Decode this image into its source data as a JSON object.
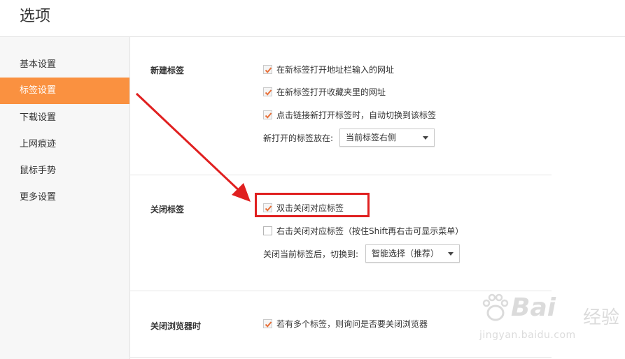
{
  "header": {
    "title": "选项"
  },
  "sidebar": {
    "items": [
      {
        "label": "基本设置",
        "active": false
      },
      {
        "label": "标签设置",
        "active": true
      },
      {
        "label": "下载设置",
        "active": false
      },
      {
        "label": "上网痕迹",
        "active": false
      },
      {
        "label": "鼠标手势",
        "active": false
      },
      {
        "label": "更多设置",
        "active": false
      }
    ]
  },
  "sections": {
    "new_tab": {
      "label": "新建标签",
      "options": [
        {
          "label": "在新标签打开地址栏输入的网址",
          "checked": true
        },
        {
          "label": "在新标签打开收藏夹里的网址",
          "checked": true
        },
        {
          "label": "点击链接新打开标签时，自动切换到该标签",
          "checked": true
        }
      ],
      "position_label": "新打开的标签放在:",
      "position_value": "当前标签右侧"
    },
    "close_tab": {
      "label": "关闭标签",
      "options": [
        {
          "label": "双击关闭对应标签",
          "checked": true
        },
        {
          "label": "右击关闭对应标签（按住Shift再右击可显示菜单）",
          "checked": false
        }
      ],
      "switch_label": "关闭当前标签后，切换到:",
      "switch_value": "智能选择（推荐）"
    },
    "close_browser": {
      "label": "关闭浏览器时",
      "options": [
        {
          "label": "若有多个标签，则询问是否要关闭浏览器",
          "checked": true
        }
      ]
    }
  },
  "watermark": {
    "brand": "Bai",
    "brand2": "经验",
    "url": "jingyan.baidu.com"
  },
  "colors": {
    "accent": "#fa9140",
    "checkmark": "#e8713a",
    "annotation": "#e02020"
  }
}
